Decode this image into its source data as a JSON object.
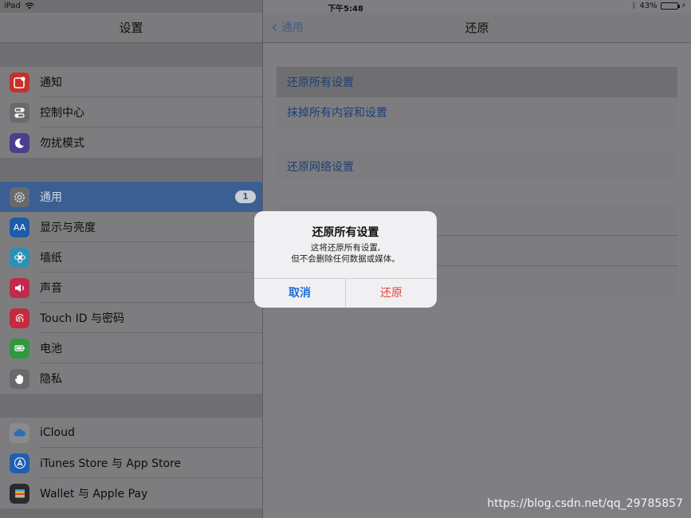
{
  "status_bar": {
    "device": "iPad",
    "time": "下午5:48",
    "battery": "43%",
    "battery_level": 0.43,
    "icons": [
      "wifi-icon",
      "bluetooth-icon",
      "battery-icon"
    ]
  },
  "left": {
    "title": "设置",
    "items": [
      {
        "label": "通知",
        "icon": "notifications-icon",
        "color": "#c8302b"
      },
      {
        "label": "控制中心",
        "icon": "control-center-icon",
        "color": "#6a6a6d"
      },
      {
        "label": "勿扰模式",
        "icon": "moon-icon",
        "color": "#4b3f8c"
      },
      {
        "label": "通用",
        "icon": "gear-icon",
        "color": "#6a6a6d",
        "badge": "1",
        "selected": true
      },
      {
        "label": "显示与亮度",
        "icon": "display-icon",
        "color": "#1e5cab"
      },
      {
        "label": "墙纸",
        "icon": "wallpaper-icon",
        "color": "#2f8fb3"
      },
      {
        "label": "声音",
        "icon": "speaker-icon",
        "color": "#c2294a"
      },
      {
        "label": "Touch ID 与密码",
        "icon": "fingerprint-icon",
        "color": "#c22c3c"
      },
      {
        "label": "电池",
        "icon": "battery-icon",
        "color": "#2f9a3c"
      },
      {
        "label": "隐私",
        "icon": "hand-icon",
        "color": "#6a6a6d"
      },
      {
        "label": "iCloud",
        "icon": "cloud-icon",
        "color": "#7d7d80"
      },
      {
        "label": "iTunes Store 与 App Store",
        "icon": "app-store-icon",
        "color": "#1f5fb0"
      },
      {
        "label": "Wallet 与 Apple Pay",
        "icon": "wallet-icon",
        "color": "#2b2b2d"
      }
    ]
  },
  "right": {
    "back_label": "通用",
    "title": "还原",
    "rows": [
      {
        "label": "还原所有设置",
        "highlight": true
      },
      {
        "label": "抹掉所有内容和设置"
      },
      {
        "label": "还原网络设置"
      }
    ]
  },
  "alert": {
    "title": "还原所有设置",
    "message_line1": "这将还原所有设置,",
    "message_line2": "但不会删除任何数据或媒体。",
    "cancel": "取消",
    "confirm": "还原"
  },
  "watermark": "https://blog.csdn.net/qq_29785857"
}
